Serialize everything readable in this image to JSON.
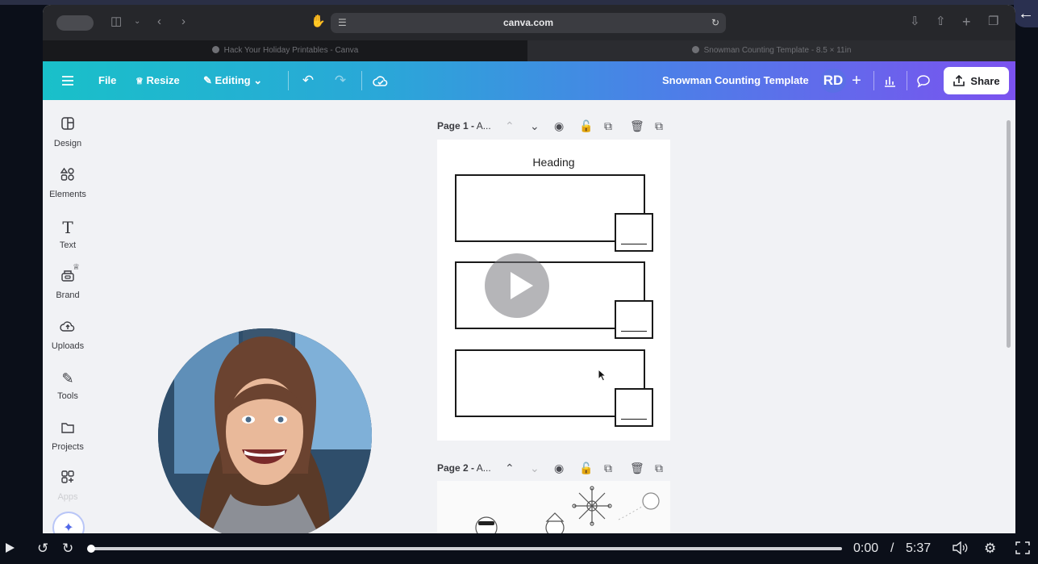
{
  "browser": {
    "url": "canva.com",
    "tabs": [
      {
        "title": "Hack Your Holiday Printables - Canva"
      },
      {
        "title": "Snowman Counting Template - 8.5 × 11in"
      }
    ]
  },
  "toolbar": {
    "file_label": "File",
    "resize_label": "Resize",
    "editing_label": "Editing",
    "design_title": "Snowman Counting Template",
    "avatar_initials": "RD",
    "share_label": "Share"
  },
  "sidebar": {
    "items": [
      {
        "label": "Design",
        "icon": "design-icon"
      },
      {
        "label": "Elements",
        "icon": "elements-icon"
      },
      {
        "label": "Text",
        "icon": "text-icon"
      },
      {
        "label": "Brand",
        "icon": "brand-icon"
      },
      {
        "label": "Uploads",
        "icon": "uploads-icon"
      },
      {
        "label": "Tools",
        "icon": "tools-icon"
      },
      {
        "label": "Projects",
        "icon": "projects-icon"
      },
      {
        "label": "Apps",
        "icon": "apps-icon"
      }
    ]
  },
  "pages": [
    {
      "label": "Page 1 -",
      "subtitle": "A..."
    },
    {
      "label": "Page 2 -",
      "subtitle": "A..."
    }
  ],
  "page1_content": {
    "heading": "Heading"
  },
  "video": {
    "current_time": "0:00",
    "separator": "/",
    "duration": "5:37",
    "progress": 0
  },
  "colors": {
    "toolbar_gradient_start": "#19c0c9",
    "toolbar_gradient_end": "#7b52ef",
    "player_background": "#0b0f19"
  }
}
